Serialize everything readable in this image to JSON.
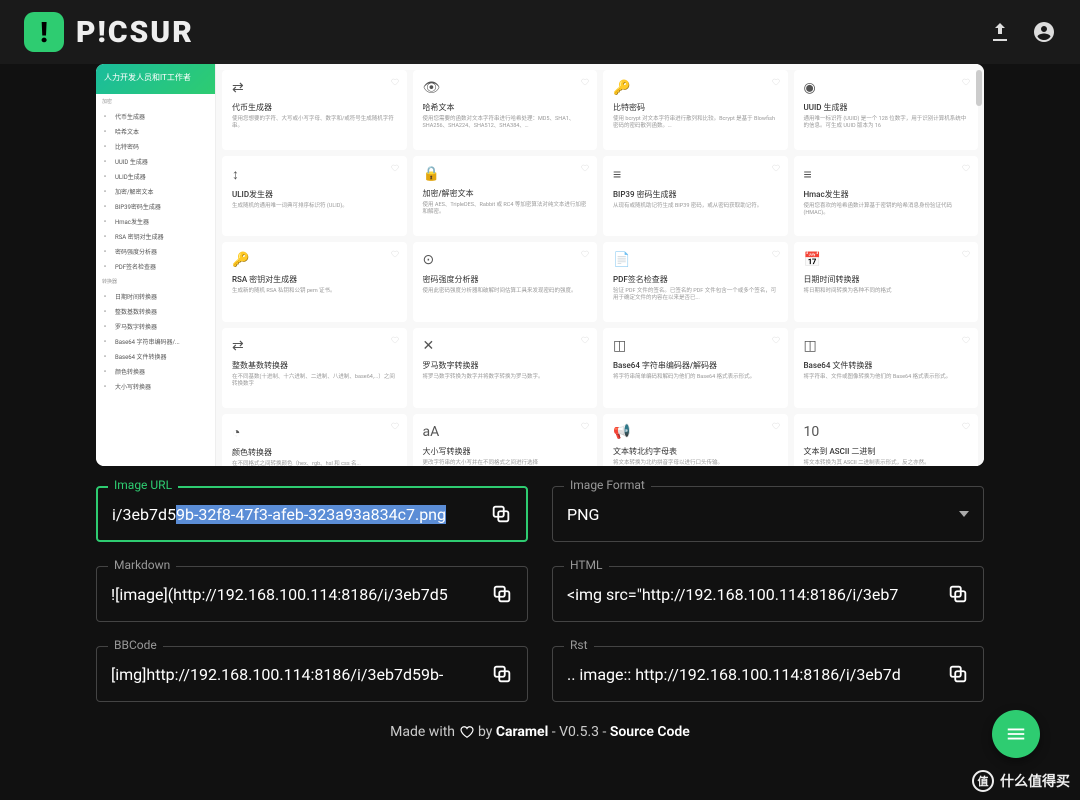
{
  "logo": {
    "badge": "!",
    "text": "P!CSUR"
  },
  "sidebar": {
    "banner": "人力开发人员和IT工作者",
    "section1": "加密",
    "section2": "转换器",
    "items1": [
      "代币生成器",
      "哈希文本",
      "比特密码",
      "UUID 生成器",
      "ULID生成器",
      "加密/解密文本",
      "BIP39密码生成器",
      "Hmac发生器",
      "RSA 密钥对生成器",
      "密码强度分析器",
      "PDF签名检查器"
    ],
    "items2": [
      "日期时间转换器",
      "整数基数转换器",
      "罗马数字转换器",
      "Base64 字符串编码器/...",
      "Base64 文件转换器",
      "颜色转换器",
      "大小写转换器"
    ]
  },
  "cards": [
    {
      "title": "代币生成器",
      "desc": "使用您想要的字符、大写或小写字母、数字和/或符号生成随机字符串。"
    },
    {
      "title": "哈希文本",
      "desc": "使用您需要的函数对文本字符串进行哈希处理：MD5、SHA1、SHA256、SHA224、SHA512、SHA384、…"
    },
    {
      "title": "比特密码",
      "desc": "使用 bcrypt 对文本字符串进行散列和比较。Bcrypt 是基于 Blowfish 密码的密码散列函数。…"
    },
    {
      "title": "UUID 生成器",
      "desc": "通用唯一标识符 (UUID) 是一个 128 位数字，用于识别计算机系统中的信息。可生成 UUID 版本为 16"
    },
    {
      "title": "ULID发生器",
      "desc": "生成随机的通用唯一词典可排序标识符 (ULID)。"
    },
    {
      "title": "加密/解密文本",
      "desc": "使用 AES、TripleDES、Rabbit 或 RC4 等加密算法对纯文本进行加密和解密。"
    },
    {
      "title": "BIP39 密码生成器",
      "desc": "从现有或随机助记符生成 BIP39 密码，或从密码获取助记符。"
    },
    {
      "title": "Hmac发生器",
      "desc": "使用您喜欢的哈希函数计算基于密钥的哈希消息身份验证代码 (HMAC)。"
    },
    {
      "title": "RSA 密钥对生成器",
      "desc": "生成新的随机 RSA 私钥和公钥 pem 证书。"
    },
    {
      "title": "密码强度分析器",
      "desc": "使用此密码强度分析器和破解时间估算工具来发现密码的强度。"
    },
    {
      "title": "PDF签名检查器",
      "desc": "验证 PDF 文件的签名。已签名的 PDF 文件包含一个或多个签名，可用于确定文件的内容在以来是否已..."
    },
    {
      "title": "日期时间转换器",
      "desc": "将日期和时间转换为各种不同的格式"
    },
    {
      "title": "整数基数转换器",
      "desc": "在不同基数(十进制、十六进制、二进制、八进制、base64,...）之间转换数字"
    },
    {
      "title": "罗马数字转换器",
      "desc": "将罗马数字转换为数字并将数字转换为罗马数字。"
    },
    {
      "title": "Base64 字符串编码器/解码器",
      "desc": "将字符串简单编码和解码为他们的 Base64 格式表示形式。"
    },
    {
      "title": "Base64 文件转换器",
      "desc": "将字符串、文件或图像转换为他们的 Base64 格式表示形式。"
    },
    {
      "title": "颜色转换器",
      "desc": "在不同格式之间转换颜色（hex、rgb、hsl 和 css 名..."
    },
    {
      "title": "大小写转换器",
      "desc": "更改字符串的大小写并在不同格式之间进行选择"
    },
    {
      "title": "文本转北约字母表",
      "desc": "将文本转换为北约拼音字母以进行口头传输。"
    },
    {
      "title": "文本到 ASCII 二进制",
      "desc": "将文本转换为其 ASCII 二进制表示形式，反之亦然。"
    }
  ],
  "fields": {
    "imageUrl": {
      "label": "Image URL",
      "prefix": "i/3eb7d5",
      "selected": "9b-32f8-47f3-afeb-323a93a834c7.png"
    },
    "imageFormat": {
      "label": "Image Format",
      "value": "PNG"
    },
    "markdown": {
      "label": "Markdown",
      "value": "![image](http://192.168.100.114:8186/i/3eb7d5"
    },
    "html": {
      "label": "HTML",
      "value": "<img src=\"http://192.168.100.114:8186/i/3eb7"
    },
    "bbcode": {
      "label": "BBCode",
      "value": "[img]http://192.168.100.114:8186/i/3eb7d59b-"
    },
    "rst": {
      "label": "Rst",
      "value": ".. image:: http://192.168.100.114:8186/i/3eb7d"
    }
  },
  "footer": {
    "made": "Made with ",
    "by": " by ",
    "author": "Caramel",
    "ver": " - V0.5.3 - ",
    "source": "Source Code"
  },
  "watermark": "什么值得买"
}
